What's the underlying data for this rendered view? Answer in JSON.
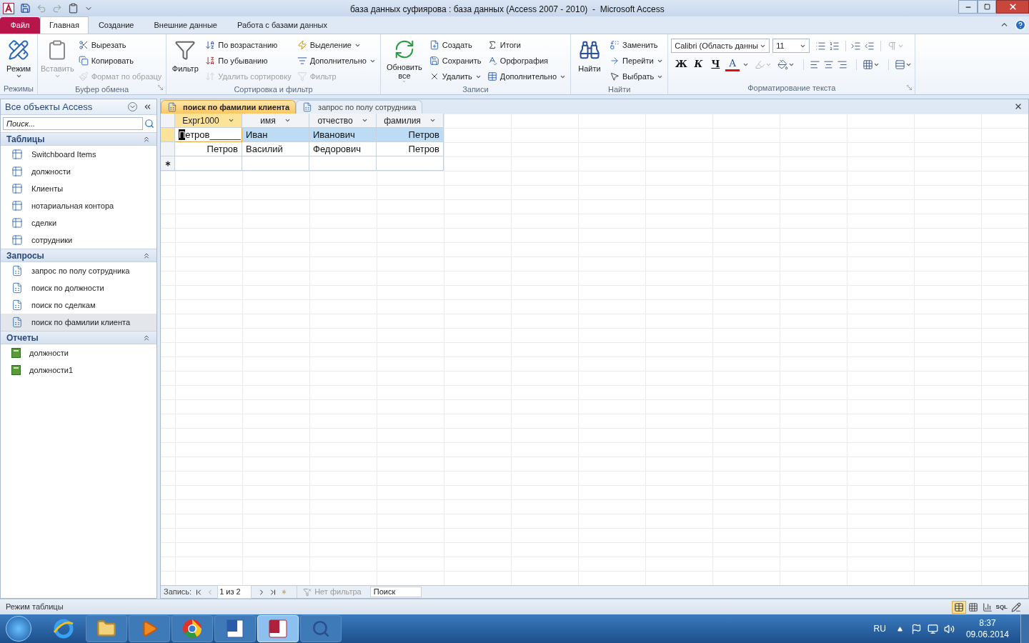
{
  "title_bar": {
    "title": "база данных суфиярова : база данных (Access 2007 - 2010)  -  Microsoft Access"
  },
  "ribbon_tabs": [
    {
      "label": "Файл",
      "kind": "file",
      "selected": false
    },
    {
      "label": "Главная",
      "kind": "tab",
      "selected": true
    },
    {
      "label": "Создание",
      "kind": "tab",
      "selected": false
    },
    {
      "label": "Внешние данные",
      "kind": "tab",
      "selected": false
    },
    {
      "label": "Работа с базами данных",
      "kind": "tab",
      "selected": false
    }
  ],
  "ribbon_groups": [
    {
      "label": "Режимы",
      "kind": "buttons",
      "launcher": false,
      "large": [
        {
          "label": "Режим",
          "kind": "mode",
          "dropdown": true,
          "disabled": false
        }
      ]
    },
    {
      "label": "Буфер обмена",
      "kind": "buttons",
      "launcher": true,
      "large": [
        {
          "label": "Вставить",
          "kind": "paste",
          "dropdown": true,
          "disabled": true
        }
      ],
      "columns": [
        [
          {
            "label": "Вырезать",
            "kind": "cut",
            "dropdown": false,
            "disabled": false
          },
          {
            "label": "Копировать",
            "kind": "copy",
            "dropdown": false,
            "disabled": false
          },
          {
            "label": "Формат по образцу",
            "kind": "brush",
            "dropdown": false,
            "disabled": true
          }
        ]
      ]
    },
    {
      "label": "Сортировка и фильтр",
      "kind": "buttons",
      "launcher": false,
      "large": [
        {
          "label": "Фильтр",
          "kind": "filter",
          "dropdown": false,
          "disabled": false
        }
      ],
      "columns": [
        [
          {
            "label": "По возрастанию",
            "kind": "sort-asc",
            "dropdown": false,
            "disabled": false
          },
          {
            "label": "По убыванию",
            "kind": "sort-desc",
            "dropdown": false,
            "disabled": false
          },
          {
            "label": "Удалить сортировку",
            "kind": "clear-sort",
            "dropdown": false,
            "disabled": true
          }
        ],
        [
          {
            "label": "Выделение",
            "kind": "selection",
            "dropdown": true,
            "disabled": false
          },
          {
            "label": "Дополнительно",
            "kind": "advanced",
            "dropdown": true,
            "disabled": false
          },
          {
            "label": "Фильтр",
            "kind": "toggle-filter",
            "dropdown": false,
            "disabled": true
          }
        ]
      ]
    },
    {
      "label": "Записи",
      "kind": "buttons",
      "launcher": false,
      "large": [
        {
          "label": "Обновить все",
          "kind": "refresh",
          "dropdown": true,
          "disabled": false
        }
      ],
      "columns": [
        [
          {
            "label": "Создать",
            "kind": "new",
            "dropdown": false,
            "disabled": false
          },
          {
            "label": "Сохранить",
            "kind": "save",
            "dropdown": false,
            "disabled": false
          },
          {
            "label": "Удалить",
            "kind": "delete",
            "dropdown": true,
            "disabled": false
          }
        ],
        [
          {
            "label": "Итоги",
            "kind": "totals",
            "dropdown": false,
            "disabled": false
          },
          {
            "label": "Орфография",
            "kind": "spelling",
            "dropdown": false,
            "disabled": false
          },
          {
            "label": "Дополнительно",
            "kind": "more",
            "dropdown": true,
            "disabled": false
          }
        ]
      ]
    },
    {
      "label": "Найти",
      "kind": "buttons",
      "launcher": false,
      "large": [
        {
          "label": "Найти",
          "kind": "find",
          "dropdown": false,
          "disabled": false
        }
      ],
      "columns": [
        [
          {
            "label": "Заменить",
            "kind": "replace",
            "dropdown": false,
            "disabled": false
          },
          {
            "label": "Перейти",
            "kind": "goto",
            "dropdown": true,
            "disabled": false
          },
          {
            "label": "Выбрать",
            "kind": "select",
            "dropdown": true,
            "disabled": false
          }
        ]
      ]
    },
    {
      "label": "Форматирование текста",
      "kind": "font",
      "launcher": true,
      "font_name": "Calibri (Область данны",
      "font_size": "11",
      "styles": [
        {
          "label": "Ж",
          "kind": "bold"
        },
        {
          "label": "К",
          "kind": "italic"
        },
        {
          "label": "Ч",
          "kind": "underline"
        },
        {
          "label": "A",
          "kind": "font-color"
        }
      ]
    }
  ],
  "nav_pane": {
    "title": "Все объекты Access",
    "search": {
      "placeholder": "Поиск..."
    },
    "sections": [
      {
        "title": "Таблицы",
        "kind": "table",
        "expanded": true,
        "items": [
          {
            "label": "Switchboard Items",
            "selected": false
          },
          {
            "label": "должности",
            "selected": false
          },
          {
            "label": "Клиенты",
            "selected": false
          },
          {
            "label": "нотариальная контора",
            "selected": false
          },
          {
            "label": "сделки",
            "selected": false
          },
          {
            "label": "сотрудники",
            "selected": false
          }
        ]
      },
      {
        "title": "Запросы",
        "kind": "query",
        "expanded": true,
        "items": [
          {
            "label": "запрос по полу сотрудника",
            "selected": false
          },
          {
            "label": "поиск по должности",
            "selected": false
          },
          {
            "label": "поиск по сделкам",
            "selected": false
          },
          {
            "label": "поиск по фамилии клиента",
            "selected": true
          }
        ]
      },
      {
        "title": "Отчеты",
        "kind": "report",
        "expanded": true,
        "items": [
          {
            "label": "должности",
            "selected": false
          },
          {
            "label": "должности1",
            "selected": false
          }
        ]
      }
    ]
  },
  "document_tabs": [
    {
      "label": "поиск по фамилии клиента",
      "selected": true
    },
    {
      "label": "запрос по полу сотрудника",
      "selected": false
    }
  ],
  "datasheet": {
    "columns": [
      {
        "label": "Expr1000",
        "selected": true,
        "right_aligned": true
      },
      {
        "label": "имя",
        "selected": false,
        "right_aligned": false
      },
      {
        "label": "отчество",
        "selected": false,
        "right_aligned": false
      },
      {
        "label": "фамилия",
        "selected": false,
        "right_aligned": true
      }
    ],
    "rows": [
      {
        "cells": [
          "Петров______",
          "Иван",
          "Иванович",
          "Петров"
        ],
        "selected": true,
        "editing": true
      },
      {
        "cells": [
          "Петров",
          "Василий",
          "Федорович",
          "Петров"
        ],
        "selected": false,
        "editing": false
      }
    ]
  },
  "record_nav": {
    "label": "Запись:",
    "position": "1 из 2",
    "filter": {
      "label": "Нет фильтра",
      "disabled": true
    },
    "search": {
      "placeholder": "Поиск"
    }
  },
  "status_bar": {
    "text": "Режим таблицы",
    "views": [
      {
        "kind": "datasheet",
        "selected": true
      },
      {
        "kind": "pivot-table",
        "selected": false
      },
      {
        "kind": "pivot-chart",
        "selected": false
      },
      {
        "kind": "sql",
        "label": "SQL",
        "selected": false
      },
      {
        "kind": "design",
        "selected": false
      }
    ]
  },
  "taskbar": {
    "apps": [
      {
        "kind": "browser",
        "selected": false
      },
      {
        "kind": "folder",
        "selected": false
      },
      {
        "kind": "player",
        "selected": false
      },
      {
        "kind": "chrome",
        "selected": false
      },
      {
        "kind": "word",
        "selected": false
      },
      {
        "kind": "access",
        "selected": true
      },
      {
        "kind": "search-tool",
        "selected": false
      }
    ],
    "tray": {
      "language": "RU",
      "time": "8:37",
      "date": "09.06.2014"
    }
  }
}
